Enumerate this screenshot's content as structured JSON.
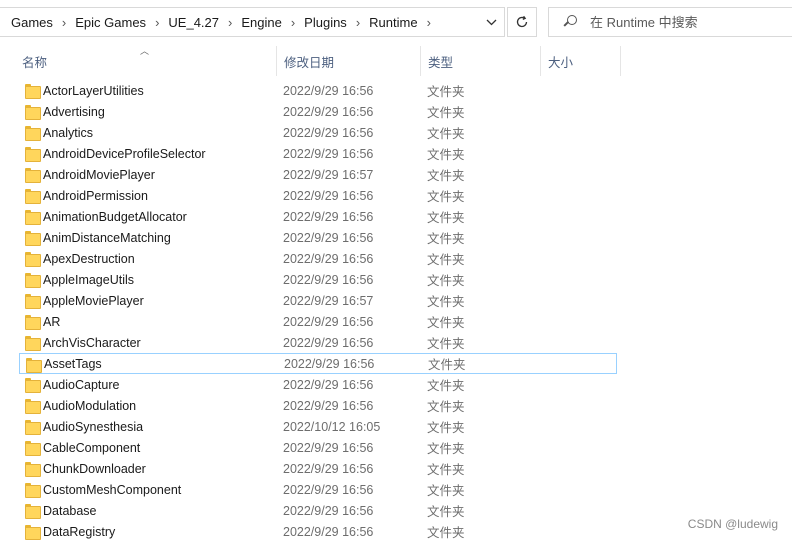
{
  "breadcrumb": [
    "Games",
    "Epic Games",
    "UE_4.27",
    "Engine",
    "Plugins",
    "Runtime"
  ],
  "search": {
    "placeholder": "在 Runtime 中搜索"
  },
  "columns": {
    "name": "名称",
    "date": "修改日期",
    "type": "类型",
    "size": "大小"
  },
  "rows": [
    {
      "name": "ActorLayerUtilities",
      "date": "2022/9/29 16:56",
      "type": "文件夹"
    },
    {
      "name": "Advertising",
      "date": "2022/9/29 16:56",
      "type": "文件夹"
    },
    {
      "name": "Analytics",
      "date": "2022/9/29 16:56",
      "type": "文件夹"
    },
    {
      "name": "AndroidDeviceProfileSelector",
      "date": "2022/9/29 16:56",
      "type": "文件夹"
    },
    {
      "name": "AndroidMoviePlayer",
      "date": "2022/9/29 16:57",
      "type": "文件夹"
    },
    {
      "name": "AndroidPermission",
      "date": "2022/9/29 16:56",
      "type": "文件夹"
    },
    {
      "name": "AnimationBudgetAllocator",
      "date": "2022/9/29 16:56",
      "type": "文件夹"
    },
    {
      "name": "AnimDistanceMatching",
      "date": "2022/9/29 16:56",
      "type": "文件夹"
    },
    {
      "name": "ApexDestruction",
      "date": "2022/9/29 16:56",
      "type": "文件夹"
    },
    {
      "name": "AppleImageUtils",
      "date": "2022/9/29 16:56",
      "type": "文件夹"
    },
    {
      "name": "AppleMoviePlayer",
      "date": "2022/9/29 16:57",
      "type": "文件夹"
    },
    {
      "name": "AR",
      "date": "2022/9/29 16:56",
      "type": "文件夹"
    },
    {
      "name": "ArchVisCharacter",
      "date": "2022/9/29 16:56",
      "type": "文件夹"
    },
    {
      "name": "AssetTags",
      "date": "2022/9/29 16:56",
      "type": "文件夹"
    },
    {
      "name": "AudioCapture",
      "date": "2022/9/29 16:56",
      "type": "文件夹"
    },
    {
      "name": "AudioModulation",
      "date": "2022/9/29 16:56",
      "type": "文件夹"
    },
    {
      "name": "AudioSynesthesia",
      "date": "2022/10/12 16:05",
      "type": "文件夹"
    },
    {
      "name": "CableComponent",
      "date": "2022/9/29 16:56",
      "type": "文件夹"
    },
    {
      "name": "ChunkDownloader",
      "date": "2022/9/29 16:56",
      "type": "文件夹"
    },
    {
      "name": "CustomMeshComponent",
      "date": "2022/9/29 16:56",
      "type": "文件夹"
    },
    {
      "name": "Database",
      "date": "2022/9/29 16:56",
      "type": "文件夹"
    },
    {
      "name": "DataRegistry",
      "date": "2022/9/29 16:56",
      "type": "文件夹"
    }
  ],
  "selected_row": "AssetTags",
  "watermark": "CSDN @ludewig",
  "colors": {
    "header_text": "#4d6080",
    "selection_border": "#99d1ff",
    "folder_fill": "#ffd65c"
  }
}
